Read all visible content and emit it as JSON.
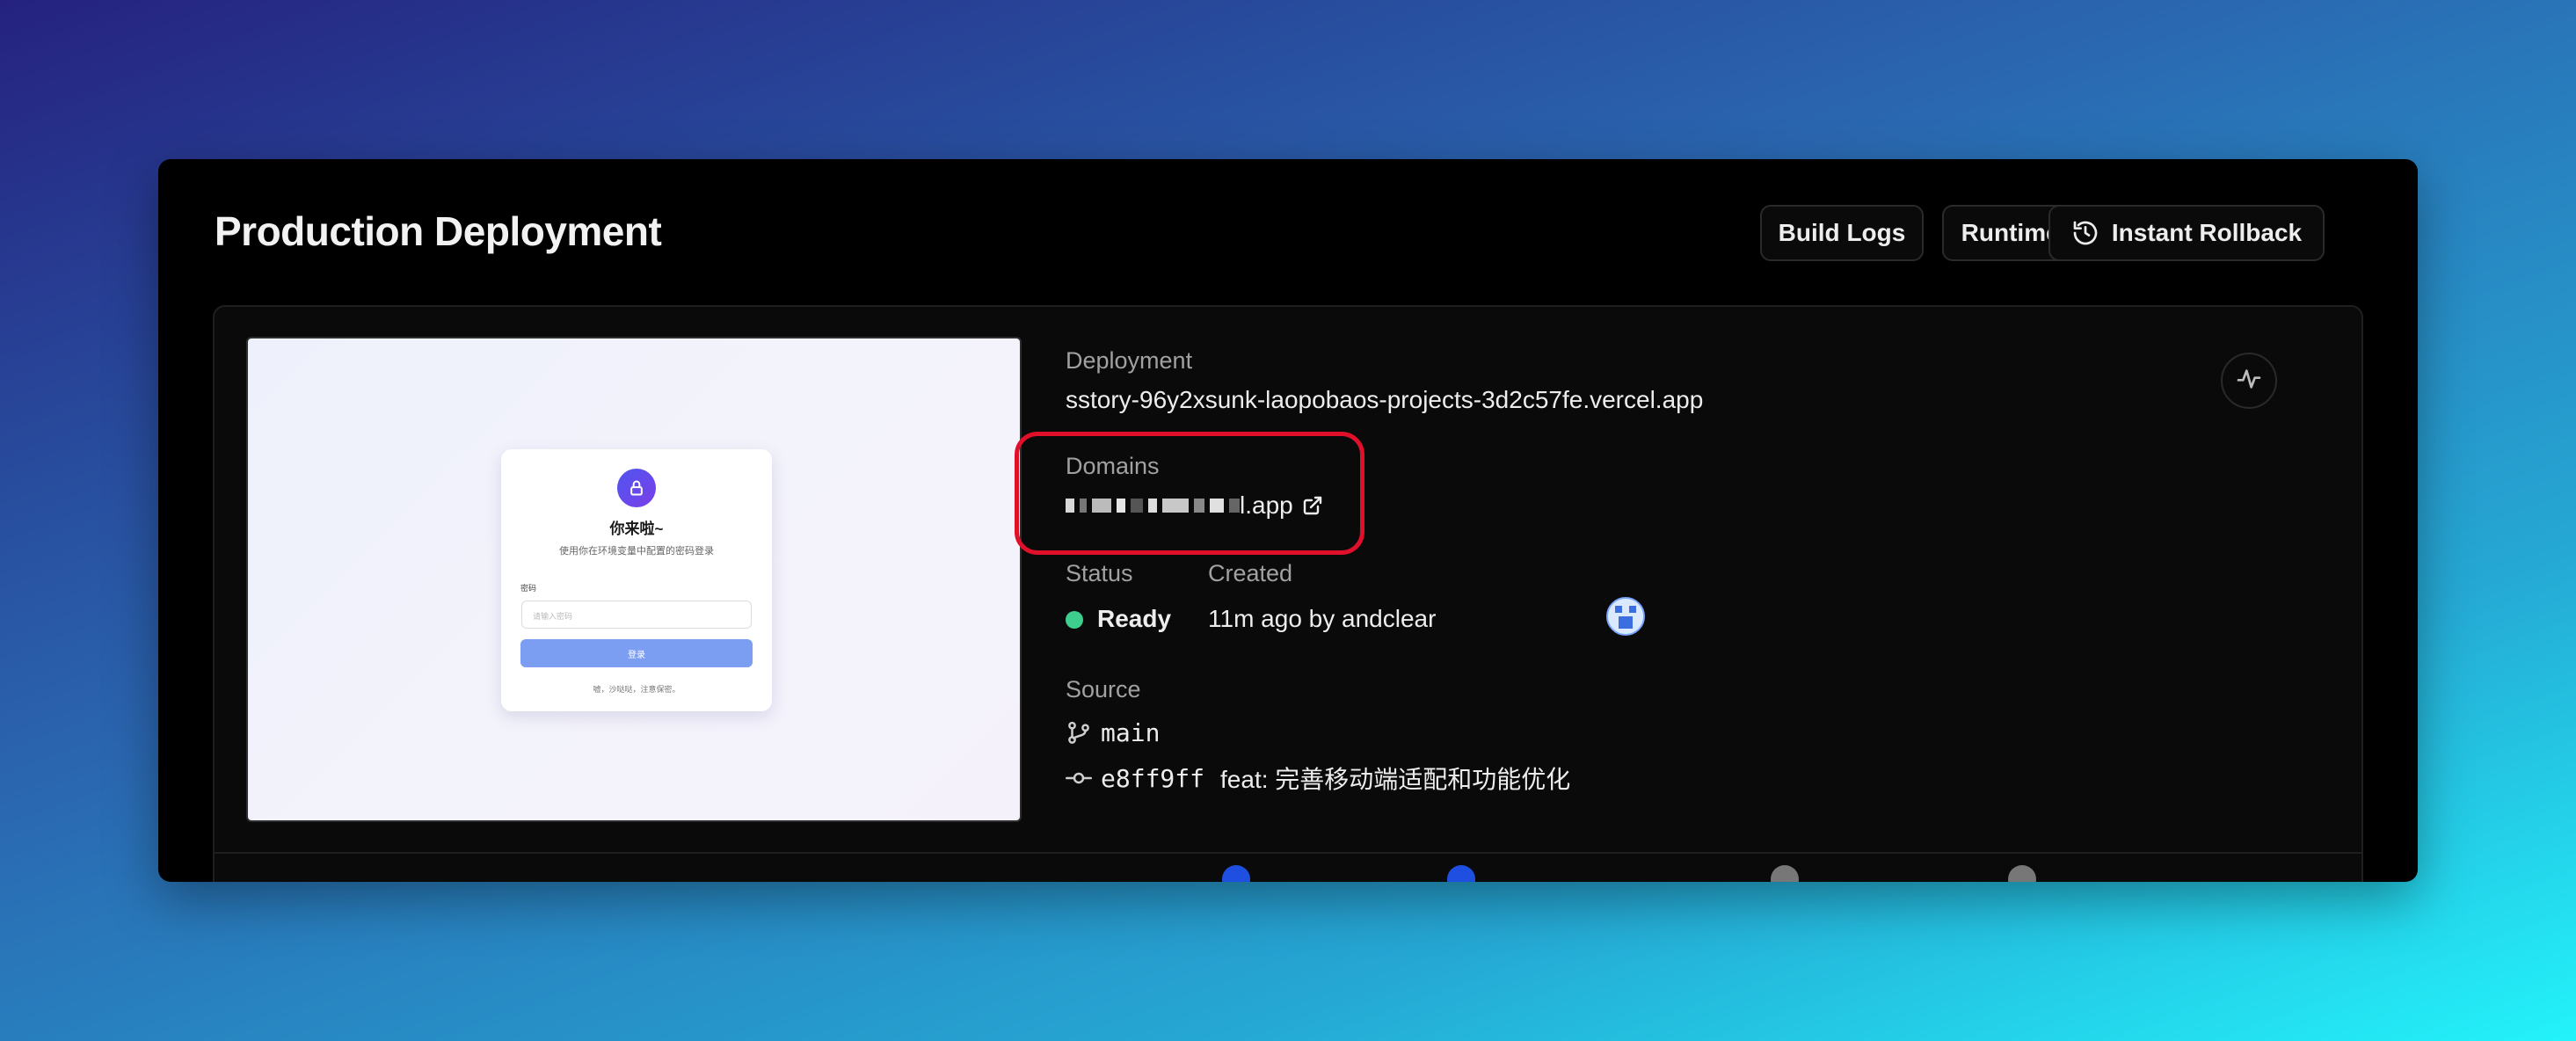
{
  "header": {
    "title": "Production Deployment",
    "build_logs": "Build Logs",
    "runtime_logs": "Runtime Logs",
    "instant_rollback": "Instant Rollback"
  },
  "preview": {
    "login_title": "你来啦~",
    "login_subtitle": "使用你在环境变量中配置的密码登录",
    "password_label": "密码",
    "password_placeholder": "请输入密码",
    "login_button": "登录",
    "footer": "嘘，沙哒哒，注意保密。"
  },
  "deployment": {
    "label": "Deployment",
    "value": "sstory-96y2xsunk-laopobaos-projects-3d2c57fe.vercel.app"
  },
  "domains": {
    "label": "Domains",
    "value_suffix": "l.app"
  },
  "status": {
    "label": "Status",
    "value": "Ready",
    "color": "#3ecf8e"
  },
  "created": {
    "label": "Created",
    "value": "11m ago by andclear"
  },
  "source": {
    "label": "Source",
    "branch": "main",
    "commit_hash": "e8ff9ff",
    "commit_message": "feat: 完善移动端适配和功能优化"
  },
  "colors": {
    "highlight": "#e0102a",
    "background_start": "#25227f",
    "background_end": "#23f3fa"
  }
}
